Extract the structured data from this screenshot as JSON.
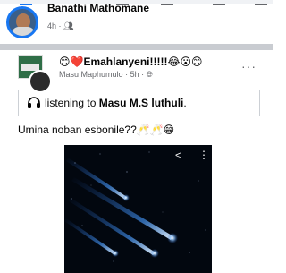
{
  "prev_post": {
    "author": "Banathi Mathomane",
    "time": "4h",
    "audience_icon": "group-icon",
    "avatar_ring_color": "#1877f2"
  },
  "post": {
    "group_name": "😊❤️Emahlanyeni!!!!!😂😮😊",
    "author": "Masu Maphumulo",
    "time": "5h",
    "audience_icon": "globe-icon",
    "listening_prefix": "listening to",
    "listening_artist": "Masu M.S luthuli",
    "text": "Umina noban esbonile??🥂🥂😁"
  },
  "colors": {
    "brand": "#1877f2",
    "meta_text": "#65676b",
    "divider": "#c9ccd1"
  }
}
